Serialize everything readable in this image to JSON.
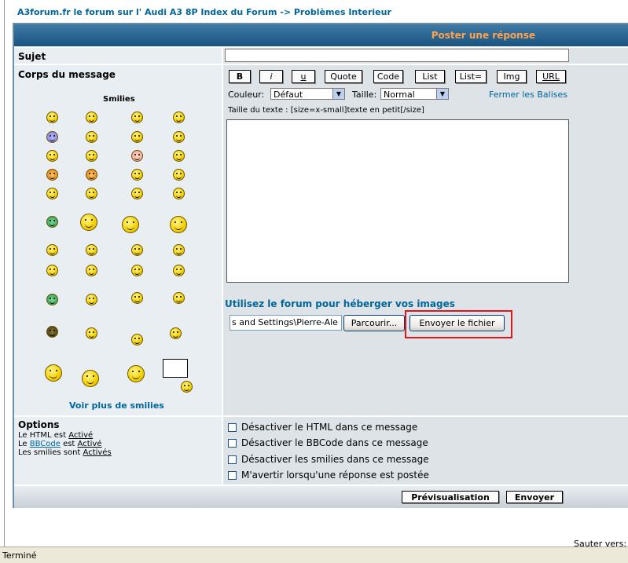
{
  "breadcrumb": {
    "site": "A3forum.fr le forum sur l' Audi A3 8P Index du Forum",
    "sep": " -> ",
    "section": "Problèmes Interieur"
  },
  "header": {
    "title": "Poster une réponse"
  },
  "subject": {
    "label": "Sujet",
    "value": ""
  },
  "body": {
    "label": "Corps du message"
  },
  "smilies": {
    "title": "Smilies",
    "more_link": "Voir plus de smilies"
  },
  "toolbar": {
    "buttons": [
      "B",
      "i",
      "u",
      "Quote",
      "Code",
      "List",
      "List=",
      "Img",
      "URL"
    ],
    "color_label": "Couleur:",
    "color_value": "Défaut",
    "size_label": "Taille:",
    "size_value": "Normal",
    "close_tags": "Fermer les Balises",
    "help_text": "Taille du texte : [size=x-small]texte en petit[/size]"
  },
  "message": {
    "value": ""
  },
  "upload": {
    "label": "Utilisez le forum pour héberger vos images",
    "file_value": "s and Settings\\Pierre-Ale",
    "browse_label": "Parcourir...",
    "send_label": "Envoyer le fichier"
  },
  "options": {
    "title": "Options",
    "html_prefix": "Le HTML est ",
    "html_state": "Activé",
    "bbcode_prefix": "Le ",
    "bbcode_link": "BBCode",
    "bbcode_mid": " est ",
    "bbcode_state": "Activé",
    "smilies_prefix": "Les smilies sont ",
    "smilies_state": "Activés",
    "checkboxes": [
      "Désactiver le HTML dans ce message",
      "Désactiver le BBCode dans ce message",
      "Désactiver les smilies dans ce message",
      "M'avertir lorsqu'une réponse est postée"
    ]
  },
  "footer": {
    "preview": "Prévisualisation",
    "send": "Envoyer"
  },
  "misc": {
    "jump_to": "Sauter vers:"
  },
  "status_bar": {
    "text": "Terminé"
  }
}
